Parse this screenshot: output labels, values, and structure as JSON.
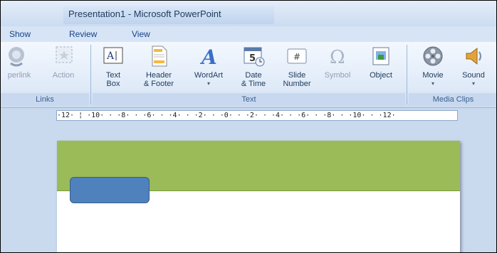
{
  "window": {
    "title": "Presentation1 - Microsoft PowerPoint"
  },
  "tabs": [
    "Show",
    "Review",
    "View"
  ],
  "ribbon": {
    "groups": {
      "links": {
        "label": "Links",
        "buttons": [
          {
            "label": "perlink",
            "icon": "hyperlink-icon"
          },
          {
            "label": "Action",
            "icon": "action-icon"
          }
        ]
      },
      "text": {
        "label": "Text",
        "buttons": [
          {
            "line1": "Text",
            "line2": "Box",
            "icon": "text-box-icon"
          },
          {
            "line1": "Header",
            "line2": "& Footer",
            "icon": "header-footer-icon"
          },
          {
            "line1": "WordArt",
            "line2": "▾",
            "icon": "wordart-icon"
          },
          {
            "line1": "Date",
            "line2": "& Time",
            "icon": "date-time-icon"
          },
          {
            "line1": "Slide",
            "line2": "Number",
            "icon": "slide-number-icon"
          },
          {
            "line1": "Symbol",
            "line2": "",
            "icon": "symbol-icon"
          },
          {
            "line1": "Object",
            "line2": "",
            "icon": "object-icon"
          }
        ]
      },
      "media": {
        "label": "Media Clips",
        "buttons": [
          {
            "line1": "Movie",
            "line2": "▾",
            "icon": "movie-icon"
          },
          {
            "line1": "Sound",
            "line2": "▾",
            "icon": "sound-icon"
          }
        ]
      }
    }
  },
  "ruler": {
    "text": "·12· ¦ ·10· · ·8· · ·6· · ·4· · ·2· · ·0· · ·2· · ·4· · ·6· · ·8· · ·10· · ·12·"
  },
  "colors": {
    "slide_band": "#9bbb59",
    "slide_shape": "#4f81bd",
    "workspace": "#c9d9ee"
  }
}
